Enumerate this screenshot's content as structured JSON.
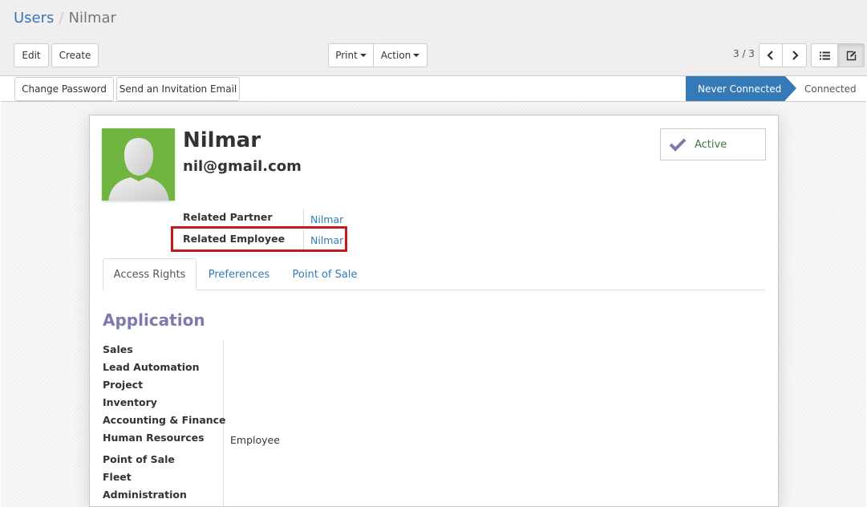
{
  "breadcrumb": {
    "parent": "Users",
    "separator": "/",
    "current": "Nilmar"
  },
  "toolbar": {
    "edit_label": "Edit",
    "create_label": "Create",
    "print_label": "Print",
    "action_label": "Action"
  },
  "pager": {
    "value": "3 / 3"
  },
  "icons": {
    "prev": "chevron-left-icon",
    "next": "chevron-right-icon",
    "list_view": "list-icon",
    "form_view": "edit-icon",
    "active": "check-icon"
  },
  "statusbar": {
    "change_password_label": "Change Password",
    "invite_label": "Send an Invitation Email",
    "stages": [
      {
        "label": "Never Connected",
        "active": true
      },
      {
        "label": "Connected",
        "active": false
      }
    ]
  },
  "user": {
    "name": "Nilmar",
    "email": "nil@gmail.com",
    "active_label": "Active"
  },
  "fields": [
    {
      "label": "Related Partner",
      "value": "Nilmar"
    },
    {
      "label": "Related Employee",
      "value": "Nilmar",
      "highlighted": true
    }
  ],
  "tabs": [
    {
      "label": "Access Rights",
      "active": true
    },
    {
      "label": "Preferences",
      "active": false
    },
    {
      "label": "Point of Sale",
      "active": false
    }
  ],
  "application": {
    "title": "Application",
    "rows": [
      {
        "label": "Sales",
        "value": ""
      },
      {
        "label": "Lead Automation",
        "value": ""
      },
      {
        "label": "Project",
        "value": ""
      },
      {
        "label": "Inventory",
        "value": ""
      },
      {
        "label": "Accounting & Finance",
        "value": ""
      },
      {
        "label": "Human Resources",
        "value": "Employee"
      },
      {
        "label": "Point of Sale",
        "value": ""
      },
      {
        "label": "Fleet",
        "value": ""
      },
      {
        "label": "Administration",
        "value": ""
      }
    ]
  },
  "colors": {
    "link": "#337ab7",
    "accent": "#7c7bad",
    "highlight": "#c9171e",
    "avatar_bg": "#6fb540",
    "active_stage": "#337ab7"
  }
}
